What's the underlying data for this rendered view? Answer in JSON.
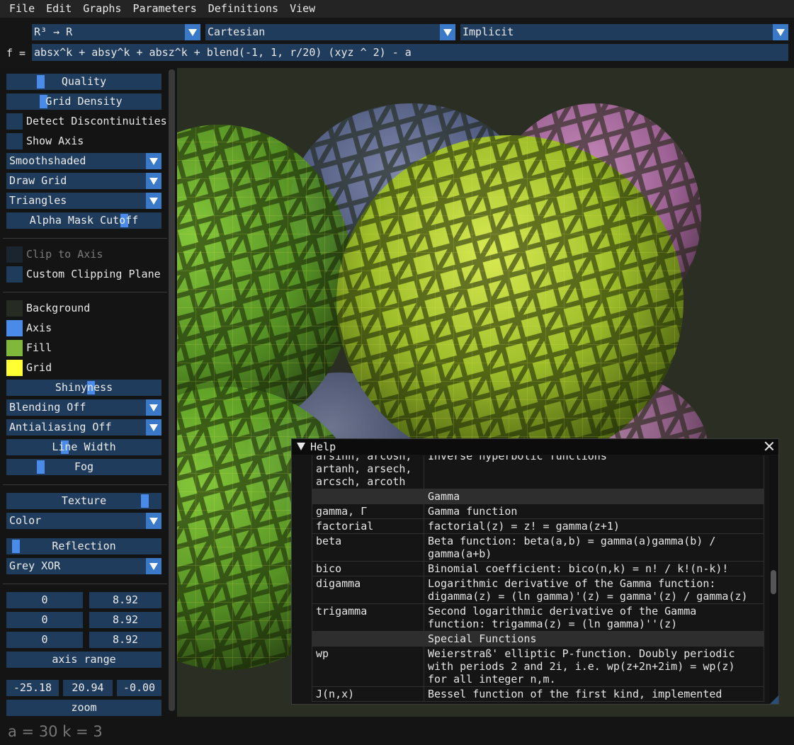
{
  "menu": [
    "File",
    "Edit",
    "Graphs",
    "Parameters",
    "Definitions",
    "View"
  ],
  "header": {
    "domain_combo": "R³ → R",
    "coords_combo": "Cartesian",
    "mode_combo": "Implicit",
    "formula_label": "f =",
    "formula": "absx^k + absy^k + absz^k + blend(-1, 1, r/20) (xyz ^ 2) - a"
  },
  "sidebar": {
    "quality": "Quality",
    "quality_level": 0.2,
    "grid_density": "Grid Density",
    "grid_density_level": 0.22,
    "detect_discontinuities": "Detect Discontinuities",
    "show_axis": "Show Axis",
    "shading": "Smoothshaded",
    "grid_mode": "Draw Grid",
    "mesh_mode": "Triangles",
    "alpha_mask": "Alpha Mask Cutoff",
    "alpha_mask_level": 0.78,
    "clip_to_axis": "Clip to Axis",
    "custom_clipping": "Custom Clipping Plane",
    "colors": [
      {
        "label": "Background",
        "color": "#262c22"
      },
      {
        "label": "Axis",
        "color": "#4a8ae8"
      },
      {
        "label": "Fill",
        "color": "#7fb83a"
      },
      {
        "label": "Grid",
        "color": "#ffff33"
      }
    ],
    "shininess": "Shinyness",
    "shininess_level": 0.55,
    "blending": "Blending Off",
    "antialiasing": "Antialiasing Off",
    "line_width": "Line Width",
    "line_width_level": 0.37,
    "fog": "Fog",
    "fog_level": 0.2,
    "texture": "Texture",
    "texture_level": 0.92,
    "texture_mode": "Color",
    "reflection": "Reflection",
    "reflection_level": 0.03,
    "reflection_mode": "Grey XOR",
    "ranges": [
      [
        "0",
        "8.92"
      ],
      [
        "0",
        "8.92"
      ],
      [
        "0",
        "8.92"
      ]
    ],
    "axis_range": "axis range",
    "center": [
      "-25.18",
      "20.94",
      "-0.00"
    ],
    "zoom": "zoom"
  },
  "status": "a = 30  k = 3",
  "help": {
    "title": "Help",
    "rows": [
      {
        "name": "arsinh, arcosh,\nartanh, arsech,\narcsch, arcoth",
        "desc": "Inverse hyperbolic functions"
      },
      {
        "section": "Gamma"
      },
      {
        "name": "gamma, Γ",
        "desc": "Gamma function"
      },
      {
        "name": "factorial",
        "desc": "factorial(z) = z! = gamma(z+1)"
      },
      {
        "name": "beta",
        "desc": "Beta function: beta(a,b) = gamma(a)gamma(b) /\ngamma(a+b)"
      },
      {
        "name": "bico",
        "desc": "Binomial coefficient: bico(n,k) = n! / k!(n-k)!"
      },
      {
        "name": "digamma",
        "desc": "Logarithmic derivative of the Gamma function:\ndigamma(z) = (ln gamma)'(z) = gamma'(z) / gamma(z)"
      },
      {
        "name": "trigamma",
        "desc": "Second logarithmic derivative of the Gamma\nfunction: trigamma(z) = (ln gamma)''(z)"
      },
      {
        "section": "Special Functions"
      },
      {
        "name": "wp",
        "desc": "Weierstraß' elliptic P-function. Doubly periodic\nwith periods 2 and 2i, i.e. wp(z+2n+2im) = wp(z)\nfor all integer n,m."
      },
      {
        "name": "J(n,x)",
        "desc": "Bessel function of the first kind, implemented"
      }
    ]
  }
}
